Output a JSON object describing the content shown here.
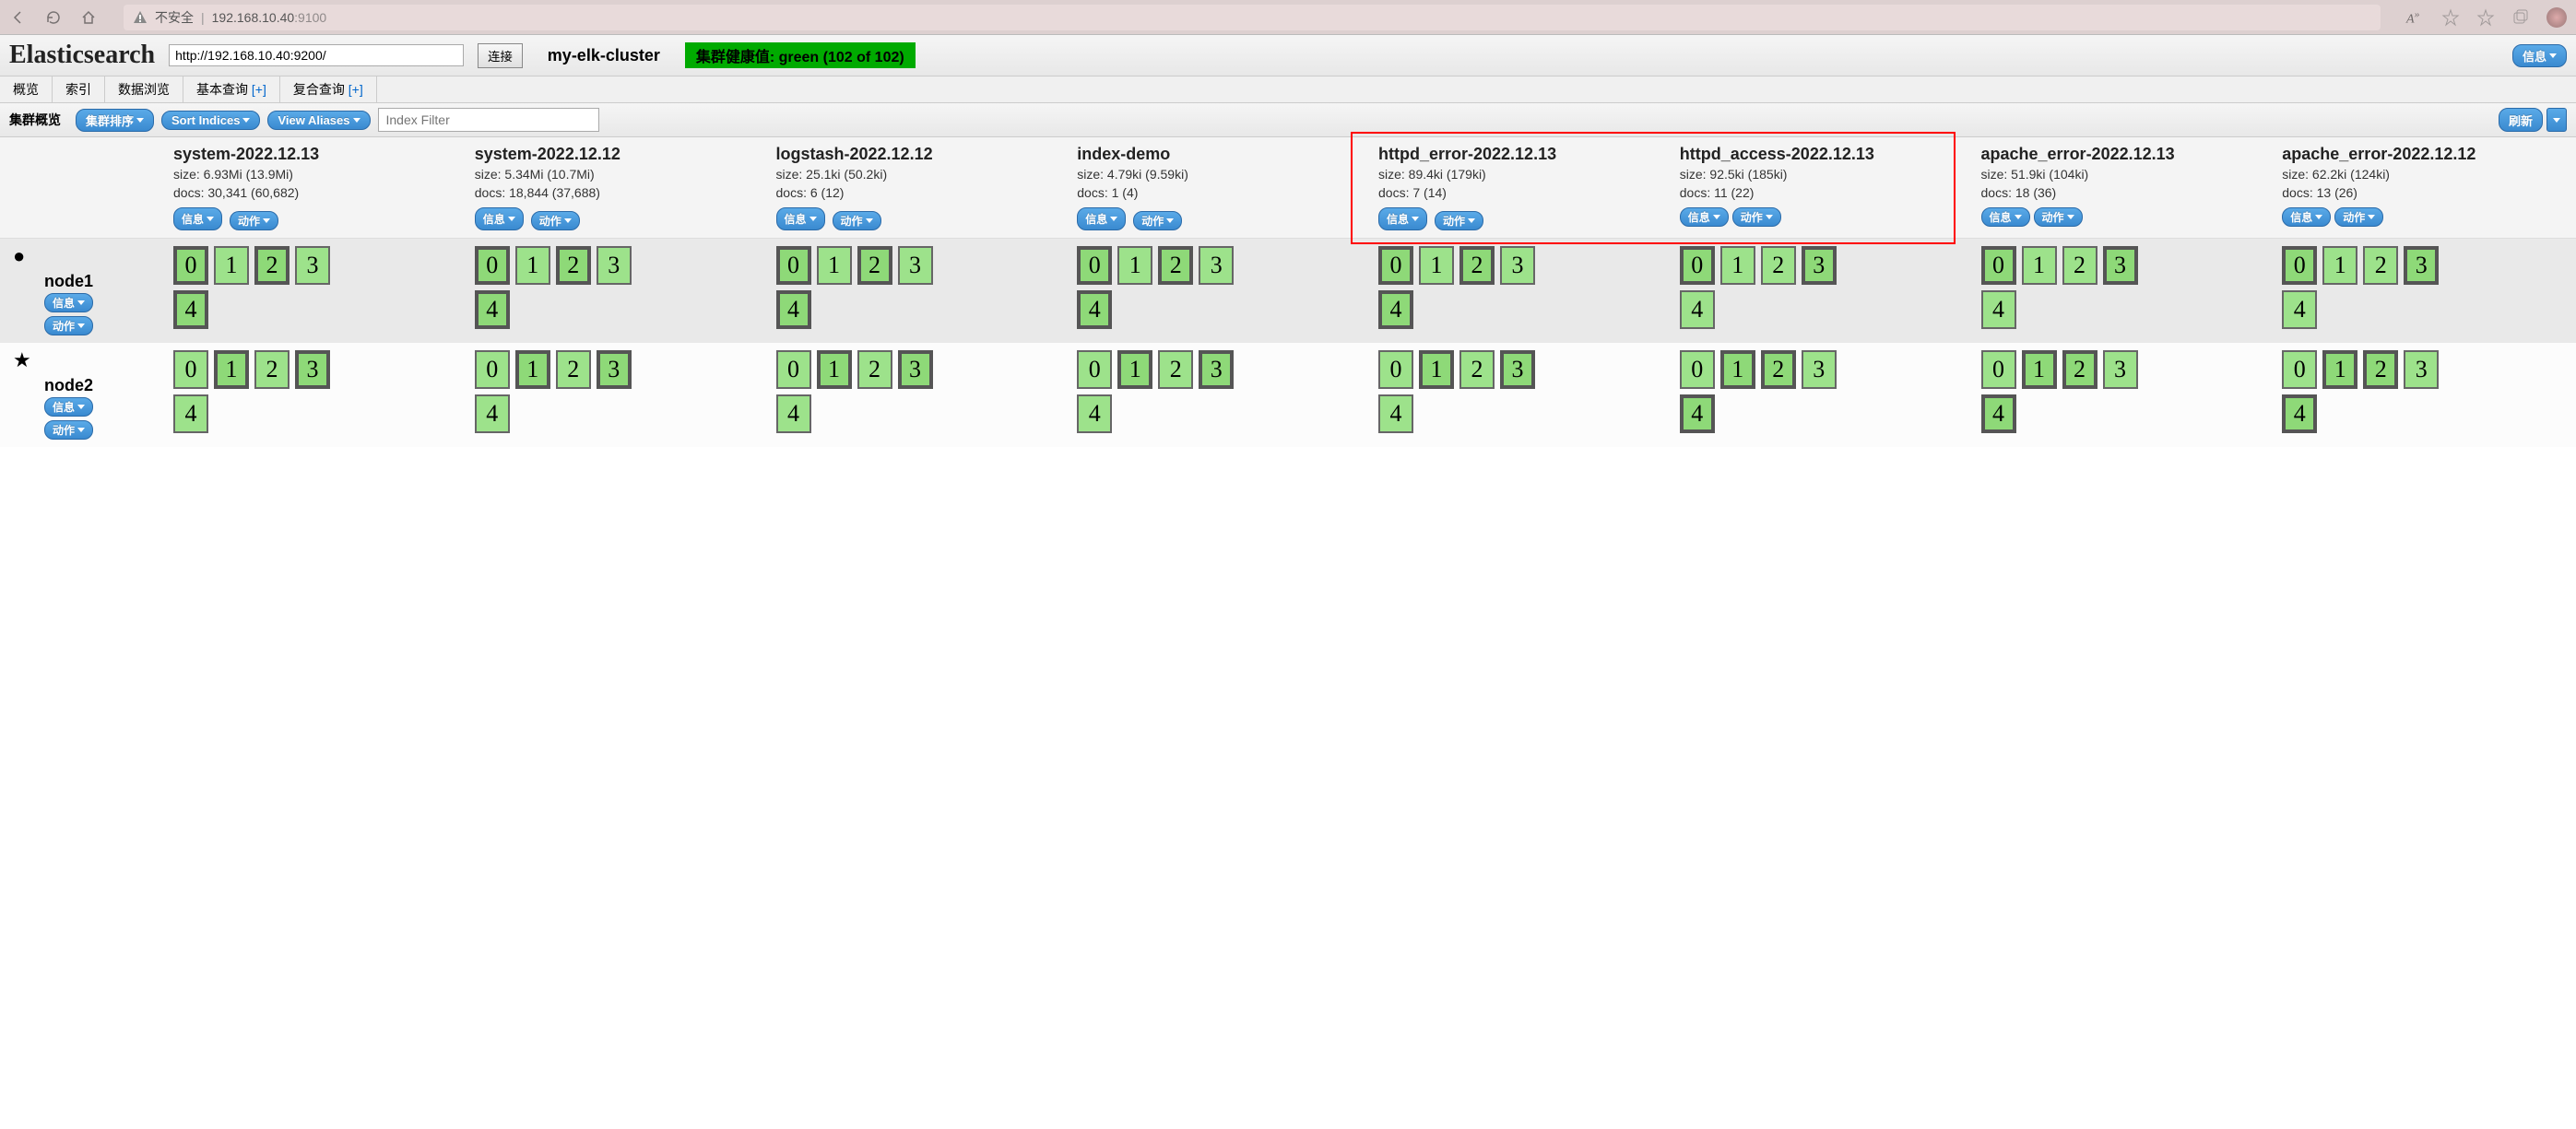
{
  "browser": {
    "insecure_label": "不安全",
    "url_host": "192.168.10.40",
    "url_port": ":9100"
  },
  "header": {
    "logo": "Elasticsearch",
    "connect_url": "http://192.168.10.40:9200/",
    "connect_btn": "连接",
    "cluster_name": "my-elk-cluster",
    "health_text": "集群健康值: green (102 of 102)",
    "info_btn": "信息"
  },
  "tabs": {
    "overview": "概览",
    "indices": "索引",
    "browse": "数据浏览",
    "basic_query": "基本查询",
    "basic_query_plus": "[+]",
    "compound_query": "复合查询",
    "compound_query_plus": "[+]"
  },
  "toolbar": {
    "label": "集群概览",
    "cluster_sort": "集群排序",
    "sort_indices": "Sort Indices",
    "view_aliases": "View Aliases",
    "filter_placeholder": "Index Filter",
    "refresh": "刷新"
  },
  "btn_labels": {
    "info": "信息",
    "action": "动作"
  },
  "indices": [
    {
      "name": "system-2022.12.13",
      "size": "size: 6.93Mi (13.9Mi)",
      "docs": "docs: 30,341 (60,682)",
      "shard_count": 5,
      "stacked": true
    },
    {
      "name": "system-2022.12.12",
      "size": "size: 5.34Mi (10.7Mi)",
      "docs": "docs: 18,844 (37,688)",
      "shard_count": 5,
      "stacked": true
    },
    {
      "name": "logstash-2022.12.12",
      "size": "size: 25.1ki (50.2ki)",
      "docs": "docs: 6 (12)",
      "shard_count": 5,
      "stacked": true
    },
    {
      "name": "index-demo",
      "size": "size: 4.79ki (9.59ki)",
      "docs": "docs: 1 (4)",
      "shard_count": 5,
      "stacked": true
    },
    {
      "name": "httpd_error-2022.12.13",
      "size": "size: 89.4ki (179ki)",
      "docs": "docs: 7 (14)",
      "shard_count": 5,
      "stacked": true,
      "highlight": true
    },
    {
      "name": "httpd_access-2022.12.13",
      "size": "size: 92.5ki (185ki)",
      "docs": "docs: 11 (22)",
      "shard_count": 5,
      "stacked": false
    },
    {
      "name": "apache_error-2022.12.13",
      "size": "size: 51.9ki (104ki)",
      "docs": "docs: 18 (36)",
      "shard_count": 5,
      "stacked": false
    },
    {
      "name": "apache_error-2022.12.12",
      "size": "size: 62.2ki (124ki)",
      "docs": "docs: 13 (26)",
      "shard_count": 5,
      "stacked": false
    }
  ],
  "nodes": [
    {
      "name": "node1",
      "icon": "●",
      "shards": [
        [
          [
            0,
            "p"
          ],
          [
            1,
            "r"
          ],
          [
            2,
            "p"
          ],
          [
            3,
            "r"
          ],
          [
            4,
            "p"
          ]
        ],
        [
          [
            0,
            "p"
          ],
          [
            1,
            "r"
          ],
          [
            2,
            "p"
          ],
          [
            3,
            "r"
          ],
          [
            4,
            "p"
          ]
        ],
        [
          [
            0,
            "p"
          ],
          [
            1,
            "r"
          ],
          [
            2,
            "p"
          ],
          [
            3,
            "r"
          ],
          [
            4,
            "p"
          ]
        ],
        [
          [
            0,
            "p"
          ],
          [
            1,
            "r"
          ],
          [
            2,
            "p"
          ],
          [
            3,
            "r"
          ],
          [
            4,
            "p"
          ]
        ],
        [
          [
            0,
            "p"
          ],
          [
            1,
            "r"
          ],
          [
            2,
            "p"
          ],
          [
            3,
            "r"
          ],
          [
            4,
            "p"
          ]
        ],
        [
          [
            0,
            "p"
          ],
          [
            1,
            "r"
          ],
          [
            2,
            "r"
          ],
          [
            3,
            "p"
          ],
          [
            4,
            "r"
          ]
        ],
        [
          [
            0,
            "p"
          ],
          [
            1,
            "r"
          ],
          [
            2,
            "r"
          ],
          [
            3,
            "p"
          ],
          [
            4,
            "r"
          ]
        ],
        [
          [
            0,
            "p"
          ],
          [
            1,
            "r"
          ],
          [
            2,
            "r"
          ],
          [
            3,
            "p"
          ],
          [
            4,
            "r"
          ]
        ]
      ]
    },
    {
      "name": "node2",
      "icon": "★",
      "shards": [
        [
          [
            0,
            "r"
          ],
          [
            1,
            "p"
          ],
          [
            2,
            "r"
          ],
          [
            3,
            "p"
          ],
          [
            4,
            "r"
          ]
        ],
        [
          [
            0,
            "r"
          ],
          [
            1,
            "p"
          ],
          [
            2,
            "r"
          ],
          [
            3,
            "p"
          ],
          [
            4,
            "r"
          ]
        ],
        [
          [
            0,
            "r"
          ],
          [
            1,
            "p"
          ],
          [
            2,
            "r"
          ],
          [
            3,
            "p"
          ],
          [
            4,
            "r"
          ]
        ],
        [
          [
            0,
            "r"
          ],
          [
            1,
            "p"
          ],
          [
            2,
            "r"
          ],
          [
            3,
            "p"
          ],
          [
            4,
            "r"
          ]
        ],
        [
          [
            0,
            "r"
          ],
          [
            1,
            "p"
          ],
          [
            2,
            "r"
          ],
          [
            3,
            "p"
          ],
          [
            4,
            "r"
          ]
        ],
        [
          [
            0,
            "r"
          ],
          [
            1,
            "p"
          ],
          [
            2,
            "p"
          ],
          [
            3,
            "r"
          ],
          [
            4,
            "p"
          ]
        ],
        [
          [
            0,
            "r"
          ],
          [
            1,
            "p"
          ],
          [
            2,
            "p"
          ],
          [
            3,
            "r"
          ],
          [
            4,
            "p"
          ]
        ],
        [
          [
            0,
            "r"
          ],
          [
            1,
            "p"
          ],
          [
            2,
            "p"
          ],
          [
            3,
            "r"
          ],
          [
            4,
            "p"
          ]
        ]
      ]
    }
  ]
}
